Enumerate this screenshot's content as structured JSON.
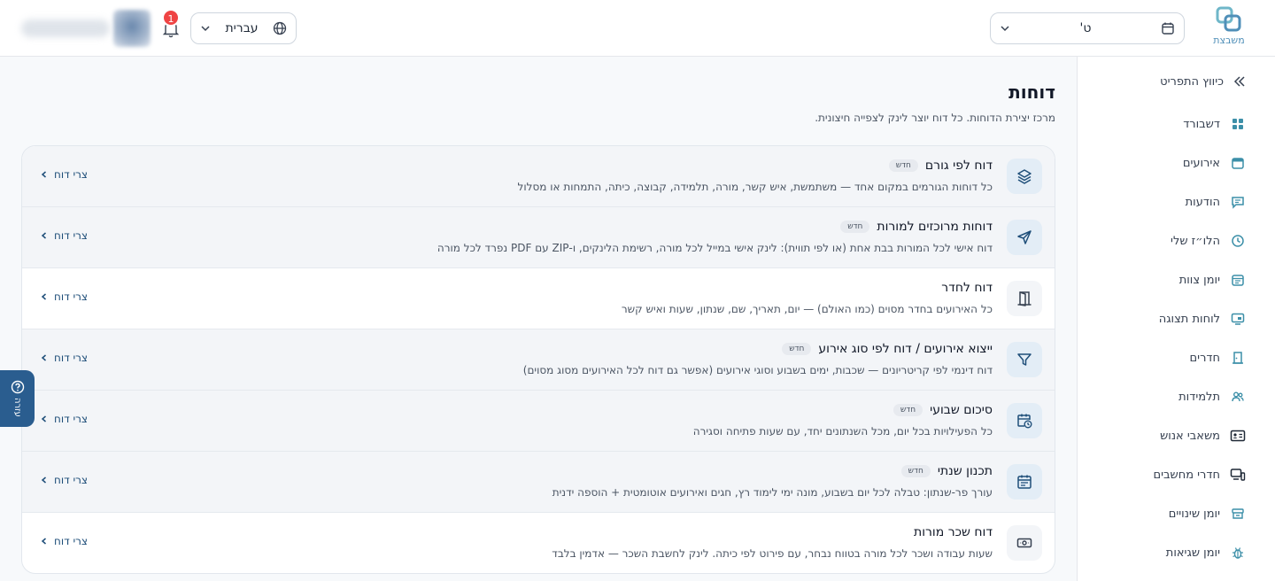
{
  "header": {
    "logo_text": "משבצת",
    "year_value": "ט'",
    "language_value": "עברית",
    "notification_count": "1"
  },
  "sidebar": {
    "collapse_label": "כיווץ התפריט",
    "items": [
      {
        "label": "דשבורד",
        "icon": "dashboard-icon"
      },
      {
        "label": "אירועים",
        "icon": "calendar-icon"
      },
      {
        "label": "הודעות",
        "icon": "message-icon"
      },
      {
        "label": "הלו״ז שלי",
        "icon": "clock-icon"
      },
      {
        "label": "יומן צוות",
        "icon": "team-calendar-icon"
      },
      {
        "label": "לוחות תצוגה",
        "icon": "monitor-icon"
      },
      {
        "label": "חדרים",
        "icon": "door-icon"
      },
      {
        "label": "תלמידות",
        "icon": "users-icon"
      },
      {
        "label": "משאבי אנוש",
        "icon": "id-card-icon"
      },
      {
        "label": "חדרי מחשבים",
        "icon": "computer-icon"
      },
      {
        "label": "יומן שינויים",
        "icon": "changelog-icon"
      },
      {
        "label": "יומן שגיאות",
        "icon": "bug-icon"
      }
    ]
  },
  "main": {
    "title": "דוחות",
    "subtitle": "מרכז יצירת הדוחות. כל דוח יוצר לינק לצפייה חיצונית.",
    "new_badge": "חדש",
    "create_label": "צרי דוח",
    "reports": [
      {
        "title": "דוח לפי גורם",
        "is_new": true,
        "desc": "כל דוחות הגורמים במקום אחד — משתמשת, איש קשר, מורה, תלמידה, קבוצה, כיתה, התמחות או מסלול",
        "icon": "layers-icon"
      },
      {
        "title": "דוחות מרוכזים למורות",
        "is_new": true,
        "desc": "דוח אישי לכל המורות בבת אחת (או לפי תווית): לינק אישי במייל לכל מורה, רשימת הלינקים, ו-ZIP עם PDF נפרד לכל מורה",
        "icon": "send-icon"
      },
      {
        "title": "דוח לחדר",
        "is_new": false,
        "desc": "כל האירועים בחדר מסוים (כמו האולם) — יום, תאריך, שם, שנתון, שעות ואיש קשר",
        "icon": "door-open-icon"
      },
      {
        "title": "ייצוא אירועים / דוח לפי סוג אירוע",
        "is_new": true,
        "desc": "דוח דינמי לפי קריטריונים — שכבות, ימים בשבוע וסוגי אירועים (אפשר גם דוח לכל האירועים מסוג מסוים)",
        "icon": "filter-icon"
      },
      {
        "title": "סיכום שבועי",
        "is_new": true,
        "desc": "כל הפעילויות בכל יום, מכל השנתונים יחד, עם שעות פתיחה וסגירה",
        "icon": "calendar-clock-icon"
      },
      {
        "title": "תכנון שנתי",
        "is_new": true,
        "desc": "עורך פר-שנתון: טבלה לכל יום בשבוע, מונה ימי לימוד רץ, חגים ואירועים אוטומטית + הוספה ידנית",
        "icon": "calendar-list-icon"
      },
      {
        "title": "דוח שכר מורות",
        "is_new": false,
        "desc": "שעות עבודה ושכר לכל מורה בטווח נבחר, עם פירוט לפי כיתה. לינק לחשבת השכר — אדמין בלבד",
        "icon": "banknote-icon"
      }
    ]
  },
  "help": {
    "label": "עזרה"
  }
}
